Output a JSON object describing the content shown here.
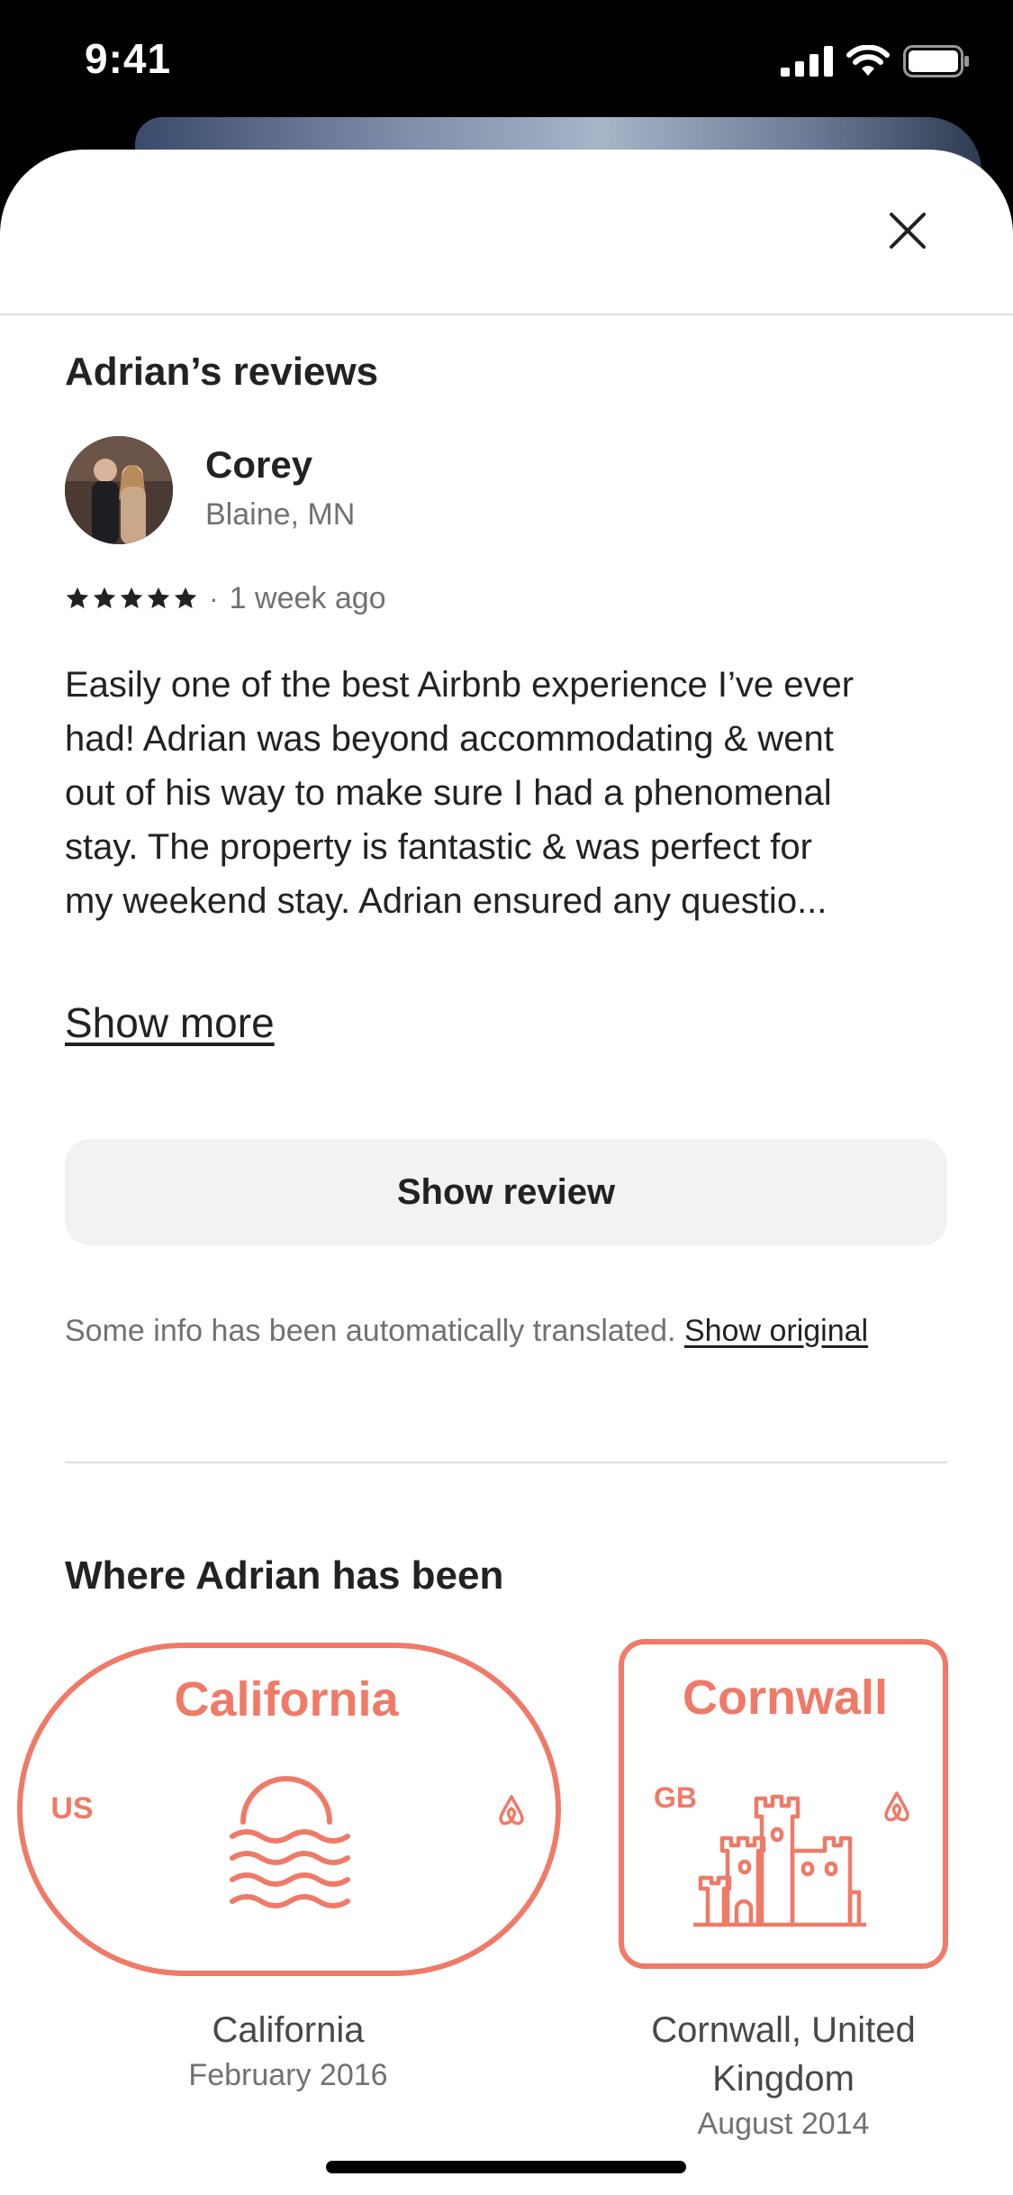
{
  "status_bar": {
    "time": "9:41"
  },
  "icons": {
    "close": "close-icon",
    "cellular": "cellular-signal-icon",
    "wifi": "wifi-icon",
    "battery": "battery-icon",
    "star": "star-icon",
    "airbnb": "airbnb-logo-icon",
    "sun": "sunset-icon",
    "castle": "castle-icon"
  },
  "colors": {
    "accent": "#EF7A67",
    "text": "#222222",
    "muted": "#717171",
    "button_bg": "#F2F2F2"
  },
  "reviews": {
    "title": "Adrian’s reviews",
    "items": [
      {
        "reviewer": "Corey",
        "location": "Blaine, MN",
        "rating": 5,
        "separator": "·",
        "date": "1 week ago",
        "text": "Easily one of the best Airbnb experience I’ve ever had! Adrian was beyond accommodating & went out of his way to make sure I had a phenomenal stay. The property is fantastic & was perfect for my weekend stay. Adrian ensured any questio...",
        "show_more": "Show more"
      }
    ],
    "show_review_button": "Show review",
    "translation_note": "Some info has been automatically translated.",
    "show_original": "Show original"
  },
  "places": {
    "title": "Where Adrian has been",
    "items": [
      {
        "badge_title": "California",
        "country_code": "US",
        "name": "California",
        "date": "February 2016"
      },
      {
        "badge_title": "Cornwall",
        "country_code": "GB",
        "name": "Cornwall, United Kingdom",
        "date": "August 2014"
      }
    ]
  }
}
